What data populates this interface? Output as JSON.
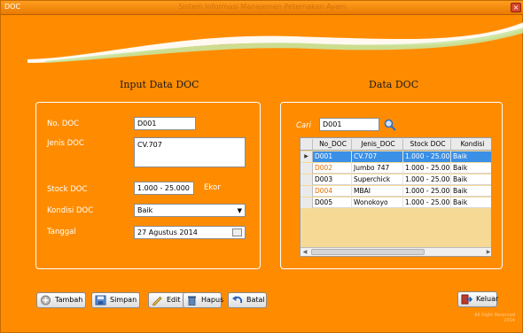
{
  "window": {
    "title": "DOC",
    "caption": "Sistem Informasi Manajemen Peternakan Ayam",
    "close_symbol": "×"
  },
  "input_section": {
    "title": "Input Data DOC",
    "labels": {
      "no_doc": "No. DOC",
      "jenis_doc": "Jenis DOC",
      "stock_doc": "Stock DOC",
      "kondisi_doc": "Kondisi DOC",
      "tanggal": "Tanggal",
      "unit": "Ekor"
    },
    "values": {
      "no_doc": "D001",
      "jenis_doc": "CV.707",
      "stock_doc": "1.000 - 25.000",
      "kondisi_doc": "Baik",
      "tanggal": "27  Agustus  2014"
    }
  },
  "data_section": {
    "title": "Data DOC",
    "search_label": "Cari",
    "search_value": "D001",
    "columns": [
      "No_DOC",
      "Jenis_DOC",
      "Stock DOC",
      "Kondisi"
    ],
    "rows": [
      [
        "D001",
        "CV.707",
        "1.000 - 25.00...",
        "Baik"
      ],
      [
        "D002",
        "Jumbo 747",
        "1.000 - 25.000",
        "Baik"
      ],
      [
        "D003",
        "Superchick",
        "1.000 - 25.000",
        "Baik"
      ],
      [
        "D004",
        "MBAI",
        "1.000 - 25.000",
        "Baik"
      ],
      [
        "D005",
        "Wonokoyo",
        "1.000 - 25.000",
        "Baik"
      ]
    ],
    "selected_row_marker": "▶"
  },
  "buttons": {
    "tambah": "Tambah",
    "simpan": "Simpan",
    "edit": "Edit",
    "hapus": "Hapus",
    "batal": "Batal",
    "keluar": "Keluar"
  },
  "footer": {
    "line1": "All Right Reserved",
    "line2": "2014"
  },
  "colors": {
    "background": "#ff8c00",
    "selected_row": "#3a8fe6",
    "grid_empty": "#f5d995"
  },
  "icons": [
    "search-icon",
    "add-icon",
    "save-icon",
    "edit-icon",
    "trash-icon",
    "undo-icon",
    "exit-icon",
    "calendar-icon",
    "chevron-down-icon"
  ]
}
